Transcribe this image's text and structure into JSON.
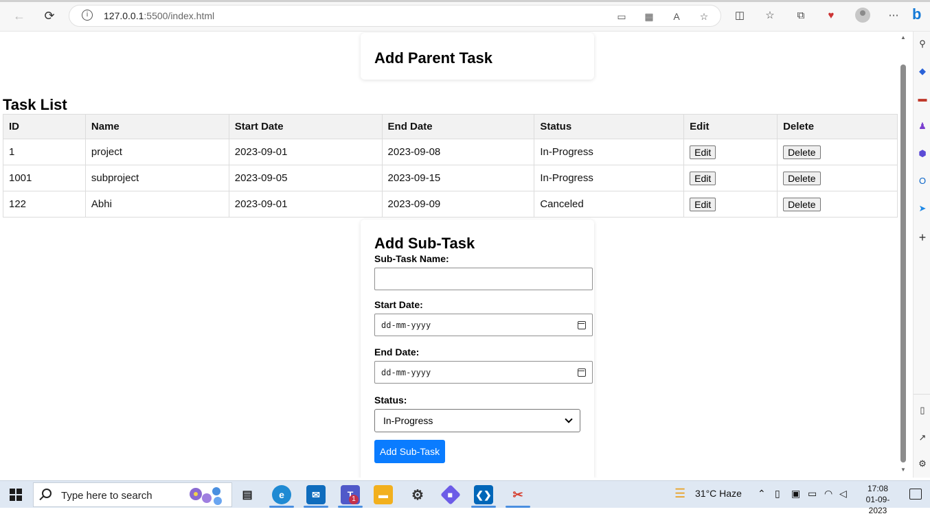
{
  "browser": {
    "url_host": "127.0.0.1",
    "url_rest": ":5500/index.html"
  },
  "page": {
    "parent_title": "Add Parent Task",
    "task_list_title": "Task List",
    "table": {
      "headers": [
        "ID",
        "Name",
        "Start Date",
        "End Date",
        "Status",
        "Edit",
        "Delete"
      ],
      "rows": [
        {
          "id": "1",
          "name": "project",
          "start": "2023-09-01",
          "end": "2023-09-08",
          "status": "In-Progress",
          "edit": "Edit",
          "delete": "Delete"
        },
        {
          "id": "1001",
          "name": "subproject",
          "start": "2023-09-05",
          "end": "2023-09-15",
          "status": "In-Progress",
          "edit": "Edit",
          "delete": "Delete"
        },
        {
          "id": "122",
          "name": "Abhi",
          "start": "2023-09-01",
          "end": "2023-09-09",
          "status": "Canceled",
          "edit": "Edit",
          "delete": "Delete"
        }
      ]
    },
    "subtask": {
      "title": "Add Sub-Task",
      "name_label": "Sub-Task Name:",
      "name_value": "",
      "start_label": "Start Date:",
      "start_placeholder": "dd-mm-yyyy",
      "end_label": "End Date:",
      "end_placeholder": "dd-mm-yyyy",
      "status_label": "Status:",
      "status_value": "In-Progress",
      "submit_label": "Add Sub-Task"
    }
  },
  "taskbar": {
    "search_placeholder": "Type here to search",
    "weather": "31°C  Haze",
    "time": "17:08",
    "date": "01-09-2023",
    "teams_badge": "1"
  },
  "colors": {
    "primary_button": "#0a7cff",
    "header_bg": "#f2f2f2"
  }
}
